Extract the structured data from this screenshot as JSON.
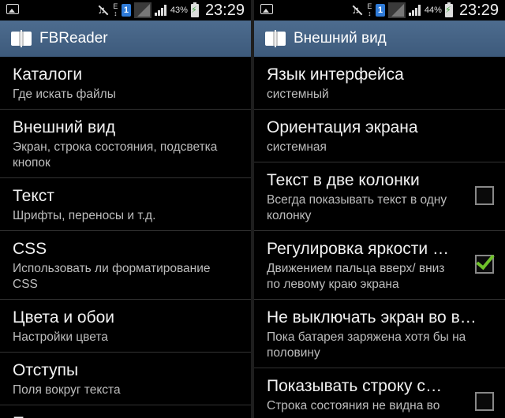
{
  "left": {
    "status": {
      "battery_pct": "43%",
      "time": "23:29",
      "sim": "1",
      "network_letter": "E"
    },
    "app_title": "FBReader",
    "items": [
      {
        "title": "Каталоги",
        "subtitle": "Где искать файлы"
      },
      {
        "title": "Внешний вид",
        "subtitle": "Экран, строка состояния, подсветка кнопок"
      },
      {
        "title": "Текст",
        "subtitle": "Шрифты, переносы и т.д."
      },
      {
        "title": "CSS",
        "subtitle": "Использовать ли форматирование CSS"
      },
      {
        "title": "Цвета и обои",
        "subtitle": "Настройки цвета"
      },
      {
        "title": "Отступы",
        "subtitle": "Поля вокруг текста"
      },
      {
        "title": "Полоса прокрутки",
        "subtitle": ""
      }
    ]
  },
  "right": {
    "status": {
      "battery_pct": "44%",
      "time": "23:29",
      "sim": "1",
      "network_letter": "E"
    },
    "app_title": "Внешний вид",
    "items": [
      {
        "title": "Язык интерфейса",
        "subtitle": "системный"
      },
      {
        "title": "Ориентация экрана",
        "subtitle": "системная"
      },
      {
        "title": "Текст в две колонки",
        "subtitle": "Всегда показывать текст в одну колонку",
        "checked": false
      },
      {
        "title": "Регулировка яркости э…",
        "subtitle": "Движением пальца вверх/ вниз по левому краю экрана",
        "checked": true
      },
      {
        "title": "Не выключать экран во в…",
        "subtitle": "Пока батарея заряжена хотя бы на половину"
      },
      {
        "title": "Показывать строку со…",
        "subtitle": "Строка состояния не видна во время чтения",
        "checked": false
      }
    ]
  },
  "colors": {
    "action_bar": "#436283",
    "check": "#6fc12a",
    "sim_badge": "#2f7bd8"
  }
}
